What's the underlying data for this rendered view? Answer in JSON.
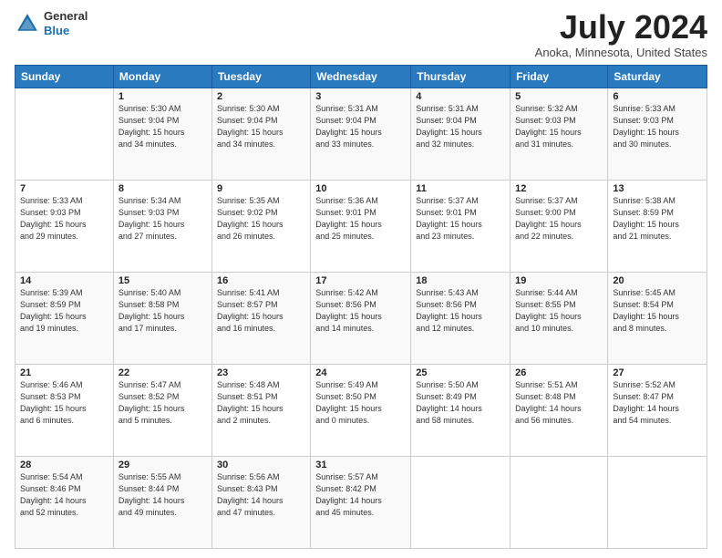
{
  "header": {
    "logo_line1": "General",
    "logo_line2": "Blue",
    "title": "July 2024",
    "subtitle": "Anoka, Minnesota, United States"
  },
  "days_of_week": [
    "Sunday",
    "Monday",
    "Tuesday",
    "Wednesday",
    "Thursday",
    "Friday",
    "Saturday"
  ],
  "weeks": [
    [
      {
        "day": "",
        "info": ""
      },
      {
        "day": "1",
        "info": "Sunrise: 5:30 AM\nSunset: 9:04 PM\nDaylight: 15 hours\nand 34 minutes."
      },
      {
        "day": "2",
        "info": "Sunrise: 5:30 AM\nSunset: 9:04 PM\nDaylight: 15 hours\nand 34 minutes."
      },
      {
        "day": "3",
        "info": "Sunrise: 5:31 AM\nSunset: 9:04 PM\nDaylight: 15 hours\nand 33 minutes."
      },
      {
        "day": "4",
        "info": "Sunrise: 5:31 AM\nSunset: 9:04 PM\nDaylight: 15 hours\nand 32 minutes."
      },
      {
        "day": "5",
        "info": "Sunrise: 5:32 AM\nSunset: 9:03 PM\nDaylight: 15 hours\nand 31 minutes."
      },
      {
        "day": "6",
        "info": "Sunrise: 5:33 AM\nSunset: 9:03 PM\nDaylight: 15 hours\nand 30 minutes."
      }
    ],
    [
      {
        "day": "7",
        "info": "Sunrise: 5:33 AM\nSunset: 9:03 PM\nDaylight: 15 hours\nand 29 minutes."
      },
      {
        "day": "8",
        "info": "Sunrise: 5:34 AM\nSunset: 9:03 PM\nDaylight: 15 hours\nand 27 minutes."
      },
      {
        "day": "9",
        "info": "Sunrise: 5:35 AM\nSunset: 9:02 PM\nDaylight: 15 hours\nand 26 minutes."
      },
      {
        "day": "10",
        "info": "Sunrise: 5:36 AM\nSunset: 9:01 PM\nDaylight: 15 hours\nand 25 minutes."
      },
      {
        "day": "11",
        "info": "Sunrise: 5:37 AM\nSunset: 9:01 PM\nDaylight: 15 hours\nand 23 minutes."
      },
      {
        "day": "12",
        "info": "Sunrise: 5:37 AM\nSunset: 9:00 PM\nDaylight: 15 hours\nand 22 minutes."
      },
      {
        "day": "13",
        "info": "Sunrise: 5:38 AM\nSunset: 8:59 PM\nDaylight: 15 hours\nand 21 minutes."
      }
    ],
    [
      {
        "day": "14",
        "info": "Sunrise: 5:39 AM\nSunset: 8:59 PM\nDaylight: 15 hours\nand 19 minutes."
      },
      {
        "day": "15",
        "info": "Sunrise: 5:40 AM\nSunset: 8:58 PM\nDaylight: 15 hours\nand 17 minutes."
      },
      {
        "day": "16",
        "info": "Sunrise: 5:41 AM\nSunset: 8:57 PM\nDaylight: 15 hours\nand 16 minutes."
      },
      {
        "day": "17",
        "info": "Sunrise: 5:42 AM\nSunset: 8:56 PM\nDaylight: 15 hours\nand 14 minutes."
      },
      {
        "day": "18",
        "info": "Sunrise: 5:43 AM\nSunset: 8:56 PM\nDaylight: 15 hours\nand 12 minutes."
      },
      {
        "day": "19",
        "info": "Sunrise: 5:44 AM\nSunset: 8:55 PM\nDaylight: 15 hours\nand 10 minutes."
      },
      {
        "day": "20",
        "info": "Sunrise: 5:45 AM\nSunset: 8:54 PM\nDaylight: 15 hours\nand 8 minutes."
      }
    ],
    [
      {
        "day": "21",
        "info": "Sunrise: 5:46 AM\nSunset: 8:53 PM\nDaylight: 15 hours\nand 6 minutes."
      },
      {
        "day": "22",
        "info": "Sunrise: 5:47 AM\nSunset: 8:52 PM\nDaylight: 15 hours\nand 5 minutes."
      },
      {
        "day": "23",
        "info": "Sunrise: 5:48 AM\nSunset: 8:51 PM\nDaylight: 15 hours\nand 2 minutes."
      },
      {
        "day": "24",
        "info": "Sunrise: 5:49 AM\nSunset: 8:50 PM\nDaylight: 15 hours\nand 0 minutes."
      },
      {
        "day": "25",
        "info": "Sunrise: 5:50 AM\nSunset: 8:49 PM\nDaylight: 14 hours\nand 58 minutes."
      },
      {
        "day": "26",
        "info": "Sunrise: 5:51 AM\nSunset: 8:48 PM\nDaylight: 14 hours\nand 56 minutes."
      },
      {
        "day": "27",
        "info": "Sunrise: 5:52 AM\nSunset: 8:47 PM\nDaylight: 14 hours\nand 54 minutes."
      }
    ],
    [
      {
        "day": "28",
        "info": "Sunrise: 5:54 AM\nSunset: 8:46 PM\nDaylight: 14 hours\nand 52 minutes."
      },
      {
        "day": "29",
        "info": "Sunrise: 5:55 AM\nSunset: 8:44 PM\nDaylight: 14 hours\nand 49 minutes."
      },
      {
        "day": "30",
        "info": "Sunrise: 5:56 AM\nSunset: 8:43 PM\nDaylight: 14 hours\nand 47 minutes."
      },
      {
        "day": "31",
        "info": "Sunrise: 5:57 AM\nSunset: 8:42 PM\nDaylight: 14 hours\nand 45 minutes."
      },
      {
        "day": "",
        "info": ""
      },
      {
        "day": "",
        "info": ""
      },
      {
        "day": "",
        "info": ""
      }
    ]
  ]
}
